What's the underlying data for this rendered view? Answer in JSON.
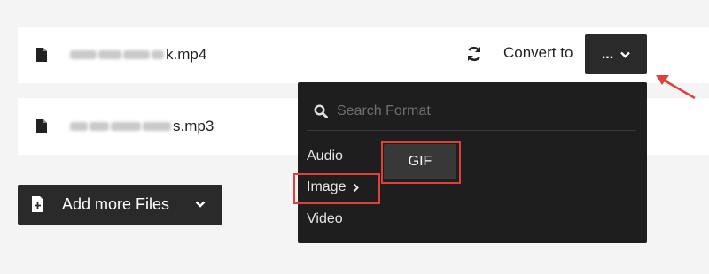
{
  "files": [
    {
      "name_suffix": "k.mp4",
      "icon": "file-icon"
    },
    {
      "name_suffix": "s.mp3",
      "icon": "file-icon"
    }
  ],
  "convert": {
    "label": "Convert to",
    "button_label": "...",
    "refresh_icon": "refresh-icon",
    "chevron_icon": "chevron-down-icon"
  },
  "add_files": {
    "label": "Add more Files",
    "icon": "add-file-icon",
    "chevron_icon": "chevron-down-icon"
  },
  "dropdown": {
    "search_placeholder": "Search Format",
    "categories": [
      {
        "label": "Audio"
      },
      {
        "label": "Image"
      },
      {
        "label": "Video"
      }
    ],
    "formats": [
      "GIF"
    ]
  },
  "colors": {
    "annotation_red": "#e0403a",
    "dark_button": "#2a2a2a",
    "dropdown_bg": "#1e1e1e"
  }
}
